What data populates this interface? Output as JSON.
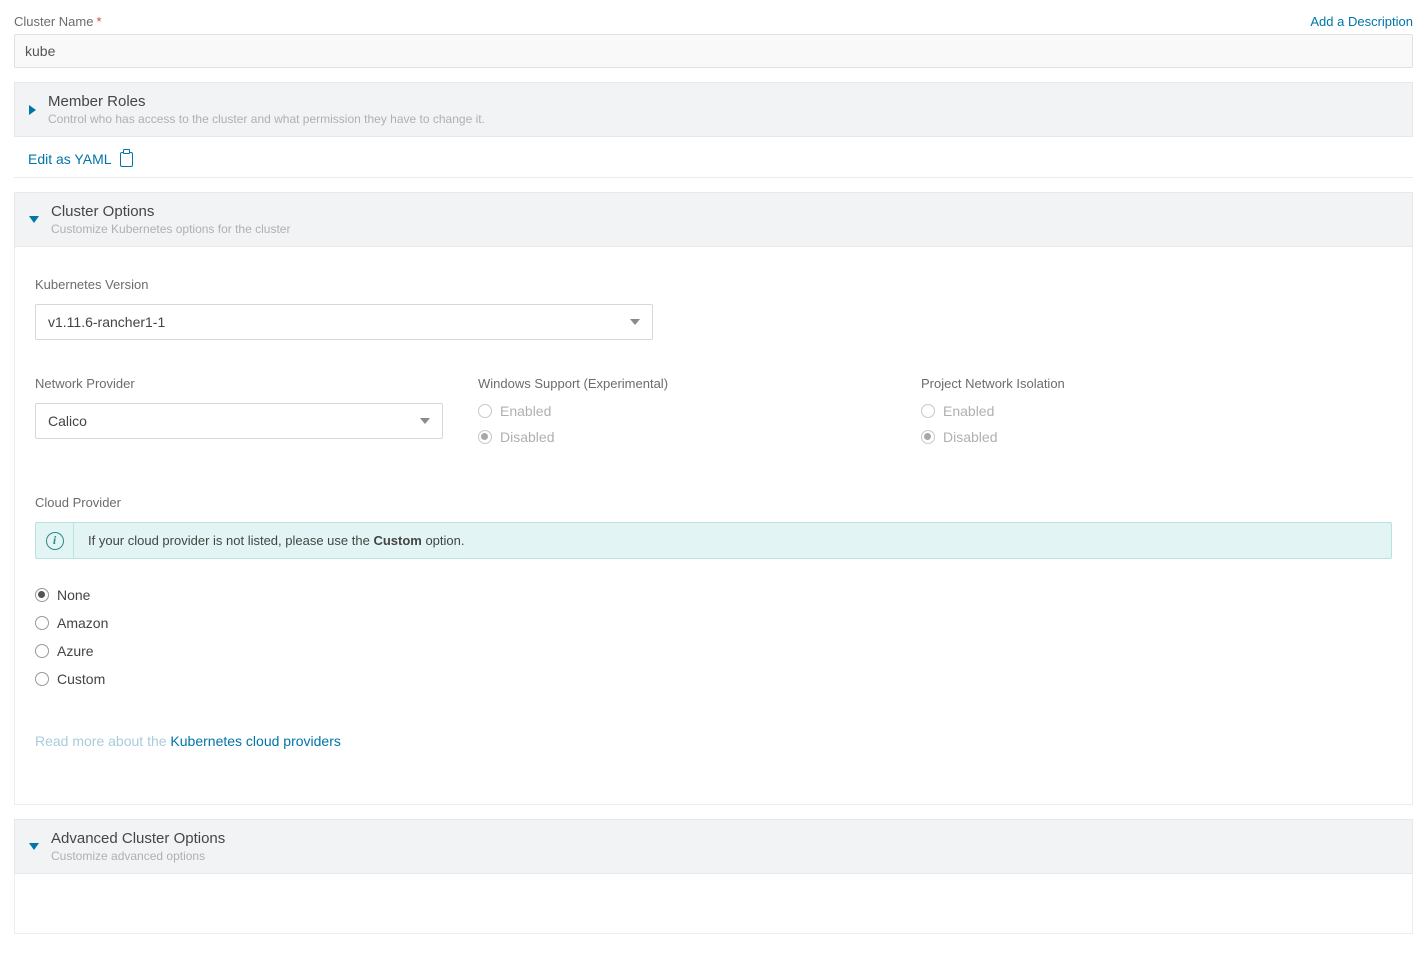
{
  "clusterName": {
    "label": "Cluster Name",
    "required": "*",
    "value": "kube"
  },
  "addDescription": "Add a Description",
  "memberRoles": {
    "title": "Member Roles",
    "sub": "Control who has access to the cluster and what permission they have to change it."
  },
  "editAsYaml": "Edit as YAML",
  "clusterOptions": {
    "title": "Cluster Options",
    "sub": "Customize Kubernetes options for the cluster"
  },
  "k8sVersion": {
    "label": "Kubernetes Version",
    "value": "v1.11.6-rancher1-1"
  },
  "networkProvider": {
    "label": "Network Provider",
    "value": "Calico"
  },
  "windowsSupport": {
    "label": "Windows Support (Experimental)",
    "options": {
      "enabled": "Enabled",
      "disabled": "Disabled"
    },
    "selected": "disabled"
  },
  "projectIsolation": {
    "label": "Project Network Isolation",
    "options": {
      "enabled": "Enabled",
      "disabled": "Disabled"
    },
    "selected": "disabled"
  },
  "cloudProvider": {
    "label": "Cloud Provider",
    "info_prefix": "If your cloud provider is not listed, please use the ",
    "info_bold": "Custom",
    "info_suffix": " option.",
    "options": {
      "none": "None",
      "amazon": "Amazon",
      "azure": "Azure",
      "custom": "Custom"
    },
    "selected": "none",
    "readMorePrefix": "Read more about the ",
    "readMoreLink": "Kubernetes cloud providers"
  },
  "advanced": {
    "title": "Advanced Cluster Options",
    "sub": "Customize advanced options"
  }
}
